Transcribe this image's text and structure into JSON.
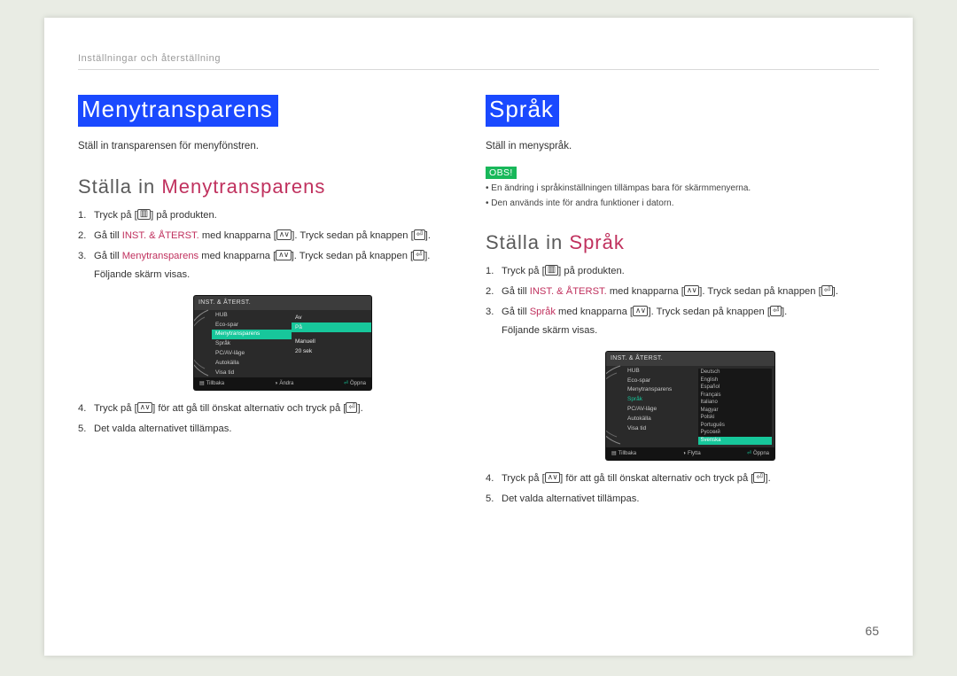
{
  "header": {
    "breadcrumb": "Inställningar och återställning"
  },
  "page_number": "65",
  "left": {
    "title": "Menytransparens",
    "intro": "Ställ in transparensen för menyfönstren.",
    "h2_prefix": "Ställa in ",
    "h2_accent": "Menytransparens",
    "steps": {
      "s1_a": "Tryck på [",
      "s1_b": "] på produkten.",
      "s2_a": "Gå till ",
      "s2_link": "INST. & ÅTERST.",
      "s2_b": " med knapparna [",
      "s2_c": "]. Tryck sedan på knappen [",
      "s2_d": "].",
      "s3_a": "Gå till ",
      "s3_link": "Menytransparens",
      "s3_b": " med knapparna [",
      "s3_c": "]. Tryck sedan på knappen [",
      "s3_d": "].",
      "s3_sub": "Följande skärm visas.",
      "s4_a": "Tryck på [",
      "s4_b": "] för att gå till önskat alternativ och tryck på [",
      "s4_c": "].",
      "s5": "Det valda alternativet tillämpas."
    },
    "osd": {
      "title": "INST. & ÅTERST.",
      "items": [
        "HUB",
        "Eco-spar",
        "Menytransparens",
        "Språk",
        "PC/AV-läge",
        "Autokälla",
        "Visa tid"
      ],
      "values": [
        "",
        "Av",
        "På",
        "",
        "",
        "Manuell",
        "20 sek"
      ],
      "highlight_index": 2,
      "footer": {
        "back": "Tillbaka",
        "adjust": "Ändra",
        "open": "Öppna"
      }
    }
  },
  "right": {
    "title": "Språk",
    "intro": "Ställ in menyspråk.",
    "obs_label": "OBS!",
    "obs_bullets": [
      "En ändring i språkinställningen tillämpas bara för skärmmenyerna.",
      "Den används inte för andra funktioner i datorn."
    ],
    "h2_prefix": "Ställa in ",
    "h2_accent": "Språk",
    "steps": {
      "s1_a": "Tryck på [",
      "s1_b": "] på produkten.",
      "s2_a": "Gå till ",
      "s2_link": "INST. & ÅTERST.",
      "s2_b": " med knapparna [",
      "s2_c": "]. Tryck sedan på knappen [",
      "s2_d": "].",
      "s3_a": "Gå till ",
      "s3_link": "Språk",
      "s3_b": " med knapparna [",
      "s3_c": "]. Tryck sedan på knappen [",
      "s3_d": "].",
      "s3_sub": "Följande skärm visas.",
      "s4_a": "Tryck på [",
      "s4_b": "] för att gå till önskat alternativ och tryck på [",
      "s4_c": "].",
      "s5": "Det valda alternativet tillämpas."
    },
    "osd": {
      "title": "INST. & ÅTERST.",
      "items": [
        "HUB",
        "Eco-spar",
        "Menytransparens",
        "Språk",
        "PC/AV-läge",
        "Autokälla",
        "Visa tid"
      ],
      "highlight_item_index": 3,
      "langs": [
        "Deutsch",
        "English",
        "Español",
        "Français",
        "Italiano",
        "Magyar",
        "Polski",
        "Português",
        "Русский",
        "Svenska"
      ],
      "lang_highlight_index": 9,
      "footer": {
        "back": "Tillbaka",
        "move": "Flytta",
        "open": "Öppna"
      }
    }
  }
}
